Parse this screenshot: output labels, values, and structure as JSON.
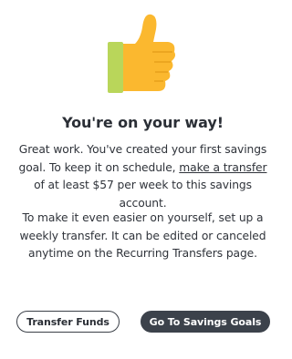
{
  "illustration": {
    "icon": "thumbs-up-icon",
    "colors": {
      "hand": "#fbb82f",
      "cuff": "#b9d65a"
    }
  },
  "title": "You're on your way!",
  "paragraph1": {
    "before": "Great work. You've created your first savings goal. To keep it on schedule, ",
    "link": "make a transfer",
    "after": " of at least $57 per week to this savings account."
  },
  "paragraph2": "To make it even easier on yourself, set up a weekly transfer. It can be edited or canceled anytime on the Recurring Transfers page.",
  "buttons": {
    "transfer_funds": "Transfer Funds",
    "go_to_savings_goals": "Go To Savings Goals"
  }
}
